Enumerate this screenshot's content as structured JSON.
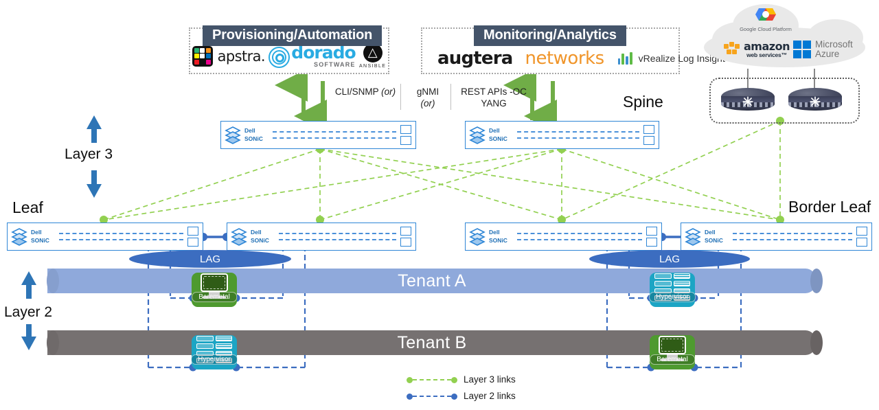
{
  "panels": [
    {
      "title": "Provisioning/Automation",
      "vendors": [
        {
          "name": "apstra",
          "word": "apstra.",
          "icon": "apstra-logo"
        },
        {
          "name": "dorado",
          "word": "dorado",
          "sub": "SOFTWARE",
          "icon": "dorado-logo"
        },
        {
          "name": "ansible",
          "word": "ANSIBLE",
          "icon": "ansible-logo"
        }
      ]
    },
    {
      "title": "Monitoring/Analytics",
      "vendors": [
        {
          "name": "augtera",
          "word": "augtera",
          "word2": "networks",
          "icon": "augtera-logo"
        },
        {
          "name": "vrealize",
          "word": "vRealize Log Insight",
          "icon": "vrealize-logo"
        }
      ]
    }
  ],
  "protocols": [
    {
      "line1": "CLI/SNMP",
      "line2": "(or)"
    },
    {
      "line1": "gNMI",
      "line2": "(or)"
    },
    {
      "line1": "REST APIs -OC",
      "line2": "YANG"
    }
  ],
  "tier_labels": {
    "spine": "Spine",
    "leaf": "Leaf",
    "border_leaf": "Border Leaf",
    "layer3": "Layer 3",
    "layer2": "Layer 2"
  },
  "switches": [
    {
      "id": "spine-1",
      "vendor": "Dell",
      "os": "SONiC",
      "role": "spine"
    },
    {
      "id": "spine-2",
      "vendor": "Dell",
      "os": "SONiC",
      "role": "spine"
    },
    {
      "id": "leaf-1",
      "vendor": "Dell",
      "os": "SONiC",
      "role": "leaf"
    },
    {
      "id": "leaf-2",
      "vendor": "Dell",
      "os": "SONiC",
      "role": "leaf"
    },
    {
      "id": "leaf-3",
      "vendor": "Dell",
      "os": "SONiC",
      "role": "leaf"
    },
    {
      "id": "leaf-4",
      "vendor": "Dell",
      "os": "SONiC",
      "role": "border-leaf"
    }
  ],
  "lags": [
    {
      "id": "lag-left",
      "label": "LAG"
    },
    {
      "id": "lag-right",
      "label": "LAG"
    }
  ],
  "tenants": [
    {
      "id": "tenant-a",
      "label": "Tenant A",
      "color": "#8FA9DB"
    },
    {
      "id": "tenant-b",
      "label": "Tenant B",
      "color": "#767171"
    }
  ],
  "servers": [
    {
      "id": "baremetal-left",
      "label": "Baremetal",
      "type": "baremetal",
      "color": "#4E9A2F"
    },
    {
      "id": "hypervisor-right",
      "label": "Hypervisor",
      "type": "hypervisor",
      "color": "#1CA5C4"
    },
    {
      "id": "hypervisor-left",
      "label": "Hypervisor",
      "type": "hypervisor",
      "color": "#1CA5C4"
    },
    {
      "id": "baremetal-right",
      "label": "Baremetal",
      "type": "baremetal",
      "color": "#4E9A2F"
    }
  ],
  "cloud": {
    "providers": [
      {
        "name": "Google Cloud Platform",
        "word": "Google Cloud Platform"
      },
      {
        "name": "amazon web services",
        "word": "amazon",
        "sub": "web services™"
      },
      {
        "name": "Microsoft Azure",
        "word": "Microsoft",
        "word2": "Azure"
      }
    ],
    "routers": [
      {
        "id": "cloud-router-1"
      },
      {
        "id": "cloud-router-2"
      }
    ]
  },
  "legend": [
    {
      "label": "Layer 3 links",
      "color": "#92D050"
    },
    {
      "label": "Layer 2 links",
      "color": "#3C6DC0"
    }
  ],
  "colors": {
    "layer3": "#92D050",
    "layer2": "#3C6DC0",
    "switch_blue": "#2E86D6",
    "panel_header": "#44546a",
    "arrow_green": "#70AD47",
    "arrow_blue": "#2E75B6"
  }
}
